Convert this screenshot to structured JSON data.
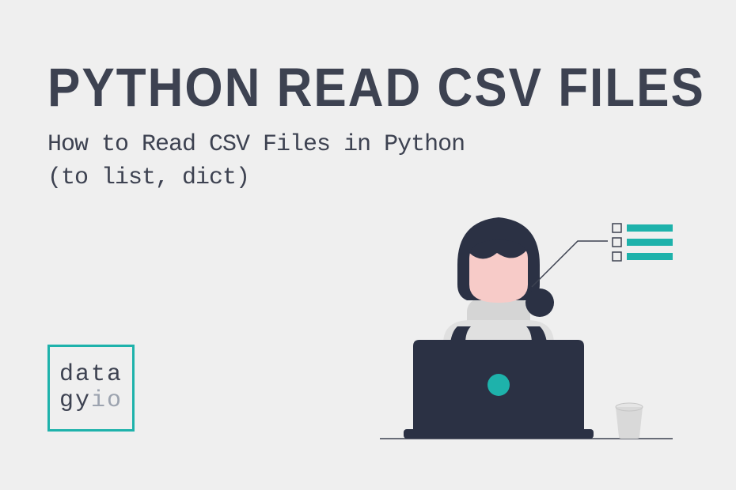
{
  "title": "PYTHON READ CSV FILES",
  "subtitle_line1": "How to Read CSV Files in Python",
  "subtitle_line2": "(to list, dict)",
  "logo": {
    "line1": "data",
    "line2_part1": "gy",
    "line2_part2": "io"
  },
  "colors": {
    "background": "#efefef",
    "text_primary": "#3d4251",
    "accent": "#1eb2ab",
    "muted": "#9ca3af",
    "laptop": "#2b3144",
    "face": "#f7cbc8",
    "cup": "#d9d9d9"
  }
}
